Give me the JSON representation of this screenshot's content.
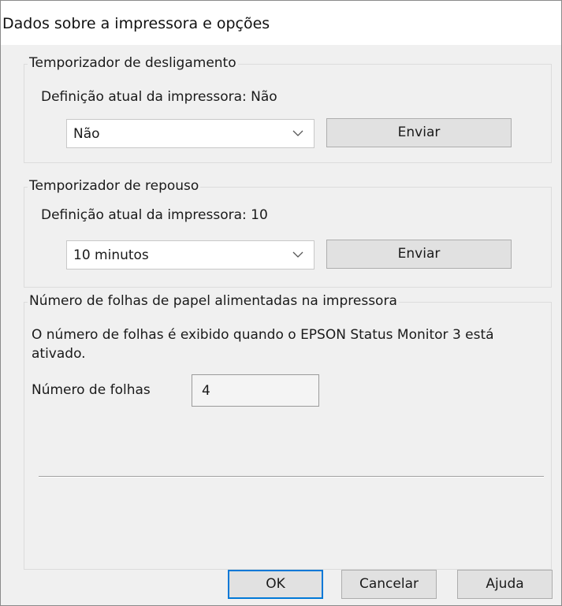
{
  "window": {
    "title": "Dados sobre a impressora e opções"
  },
  "power_off_timer": {
    "legend": "Temporizador de desligamento",
    "current_setting": "Definição atual da impressora: Não",
    "selected": "Não",
    "send_label": "Enviar"
  },
  "sleep_timer": {
    "legend": "Temporizador de repouso",
    "current_setting": "Definição atual da impressora: 10",
    "selected": "10 minutos",
    "send_label": "Enviar"
  },
  "sheets_fed": {
    "legend": "Número de folhas de papel alimentadas na impressora",
    "description_line1": "O número de folhas é exibido quando o EPSON Status Monitor 3 está",
    "description_line2": "ativado.",
    "count_label": "Número de folhas",
    "count_value": "4"
  },
  "footer": {
    "ok_label": "OK",
    "cancel_label": "Cancelar",
    "help_label": "Ajuda"
  },
  "icons": {
    "dropdown": "chevron-down-icon"
  },
  "colors": {
    "default_button_border": "#0078d7"
  }
}
